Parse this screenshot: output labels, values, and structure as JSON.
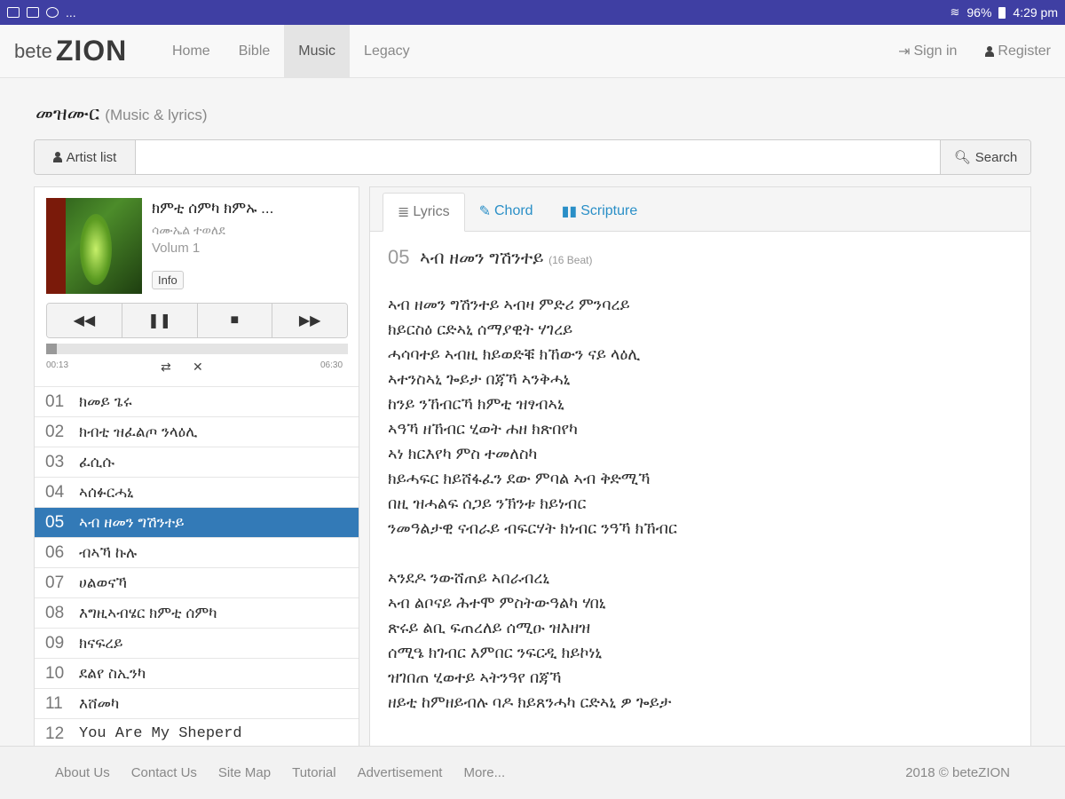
{
  "status_bar": {
    "left_dots": "...",
    "battery": "96%",
    "time": "4:29 pm"
  },
  "navbar": {
    "brand_prefix": "bete",
    "brand_main": "ZION",
    "items": [
      "Home",
      "Bible",
      "Music",
      "Legacy"
    ],
    "active": "Music",
    "sign_in": "Sign in",
    "register": "Register"
  },
  "page": {
    "title": "መዝሙር",
    "subtitle": "(Music & lyrics)"
  },
  "search": {
    "artist_button": "Artist list",
    "placeholder": "",
    "button": "Search"
  },
  "player": {
    "song_title": "ክምቲ ሰምካ ክምኡ ...",
    "artist": "ሳሙኤል ተወለደ",
    "album": "Volum 1",
    "info_label": "Info",
    "time_current": "00:13",
    "time_total": "06:30",
    "progress": 0.035,
    "controls": [
      "backward-icon",
      "pause-icon",
      "stop-icon",
      "forward-icon"
    ]
  },
  "tracks": [
    {
      "num": "01",
      "title": "ክመይ ጌሩ"
    },
    {
      "num": "02",
      "title": "ክብቲ ዝፈልጦ ንላዕሊ"
    },
    {
      "num": "03",
      "title": "ፈሲሱ"
    },
    {
      "num": "04",
      "title": "ኣሰፉርሓኒ"
    },
    {
      "num": "05",
      "title": "ኣብ ዘመን ግሽንተይ"
    },
    {
      "num": "06",
      "title": "ብኣኻ ኩሉ"
    },
    {
      "num": "07",
      "title": "ሀልወናኻ"
    },
    {
      "num": "08",
      "title": "እግዚኣብሄር ክምቲ ሰምካ"
    },
    {
      "num": "09",
      "title": "ክናፍረይ"
    },
    {
      "num": "10",
      "title": "ደልየ ስኢንካ"
    },
    {
      "num": "11",
      "title": "እሸመካ"
    },
    {
      "num": "12",
      "title": "You Are My Sheperd"
    }
  ],
  "active_track": "05",
  "tabs": {
    "lyrics": "Lyrics",
    "chord": "Chord",
    "scripture": "Scripture"
  },
  "lyrics": {
    "num": "05",
    "title": "ኣብ ዘመን ግሽንተይ",
    "beat": "(16 Beat)",
    "stanzas": [
      [
        "ኣብ ዘመን ግሽንተይ ኣብዛ ምድሪ ምንባረይ",
        "ክይርስዕ ርድኣኒ ሰማያዊት ሃገረይ",
        "ሓሳባተይ ኣብዚ ክይወድቑ ክኸውን ናይ ላዕሊ",
        "ኣተንስኣኒ ጐይታ በጃኻ ኣንቅሓኒ",
        "ከንይ ንኸብርኻ ክምቲ ዝፃብኣኒ",
        "ኣዓኻ ዘኸብር ሂወት ሐዘ ክጽበየካ",
        "ኣነ ክርእየካ ምስ ተመለስካ",
        "ክይሓፍር ክይሸፋፈን ደው ምባል ኣብ ቅድሚኻ",
        "በዚ ዝሓልፍ ሰጋይ ንኽንቱ ክይነብር",
        "ንመዓልታዊ ናብራይ ብፍርሃት ክነብር ንዓኻ ክኸብር"
      ],
      [
        "ኣንደዶ ንውሸጠይ ኣበራብረኒ",
        "ኣብ ልቦናይ ሕተሞ ምስትውዓልካ ሃበኒ",
        "ጽሩይ ልቢ ፍጠረለይ ሰሚዑ ዝእዘዝ",
        "ሰሚዔ ክገብር እምበር ንፍርዲ ክይኮነኒ",
        "ዝገበጠ ሂወተይ ኣትንዓየ በጃኻ",
        "ዘይቲ ከምዘይብሉ ባዶ ክይጸንሓካ ርድኣኒ ዎ ጐይታ"
      ]
    ]
  },
  "footer": {
    "links": [
      "About Us",
      "Contact Us",
      "Site Map",
      "Tutorial",
      "Advertisement",
      "More..."
    ],
    "copyright": "2018 © beteZION"
  },
  "colors": {
    "status_bar": "#3f3fa3",
    "active_track": "#337ab7",
    "tab_link": "#2a8fc7"
  }
}
